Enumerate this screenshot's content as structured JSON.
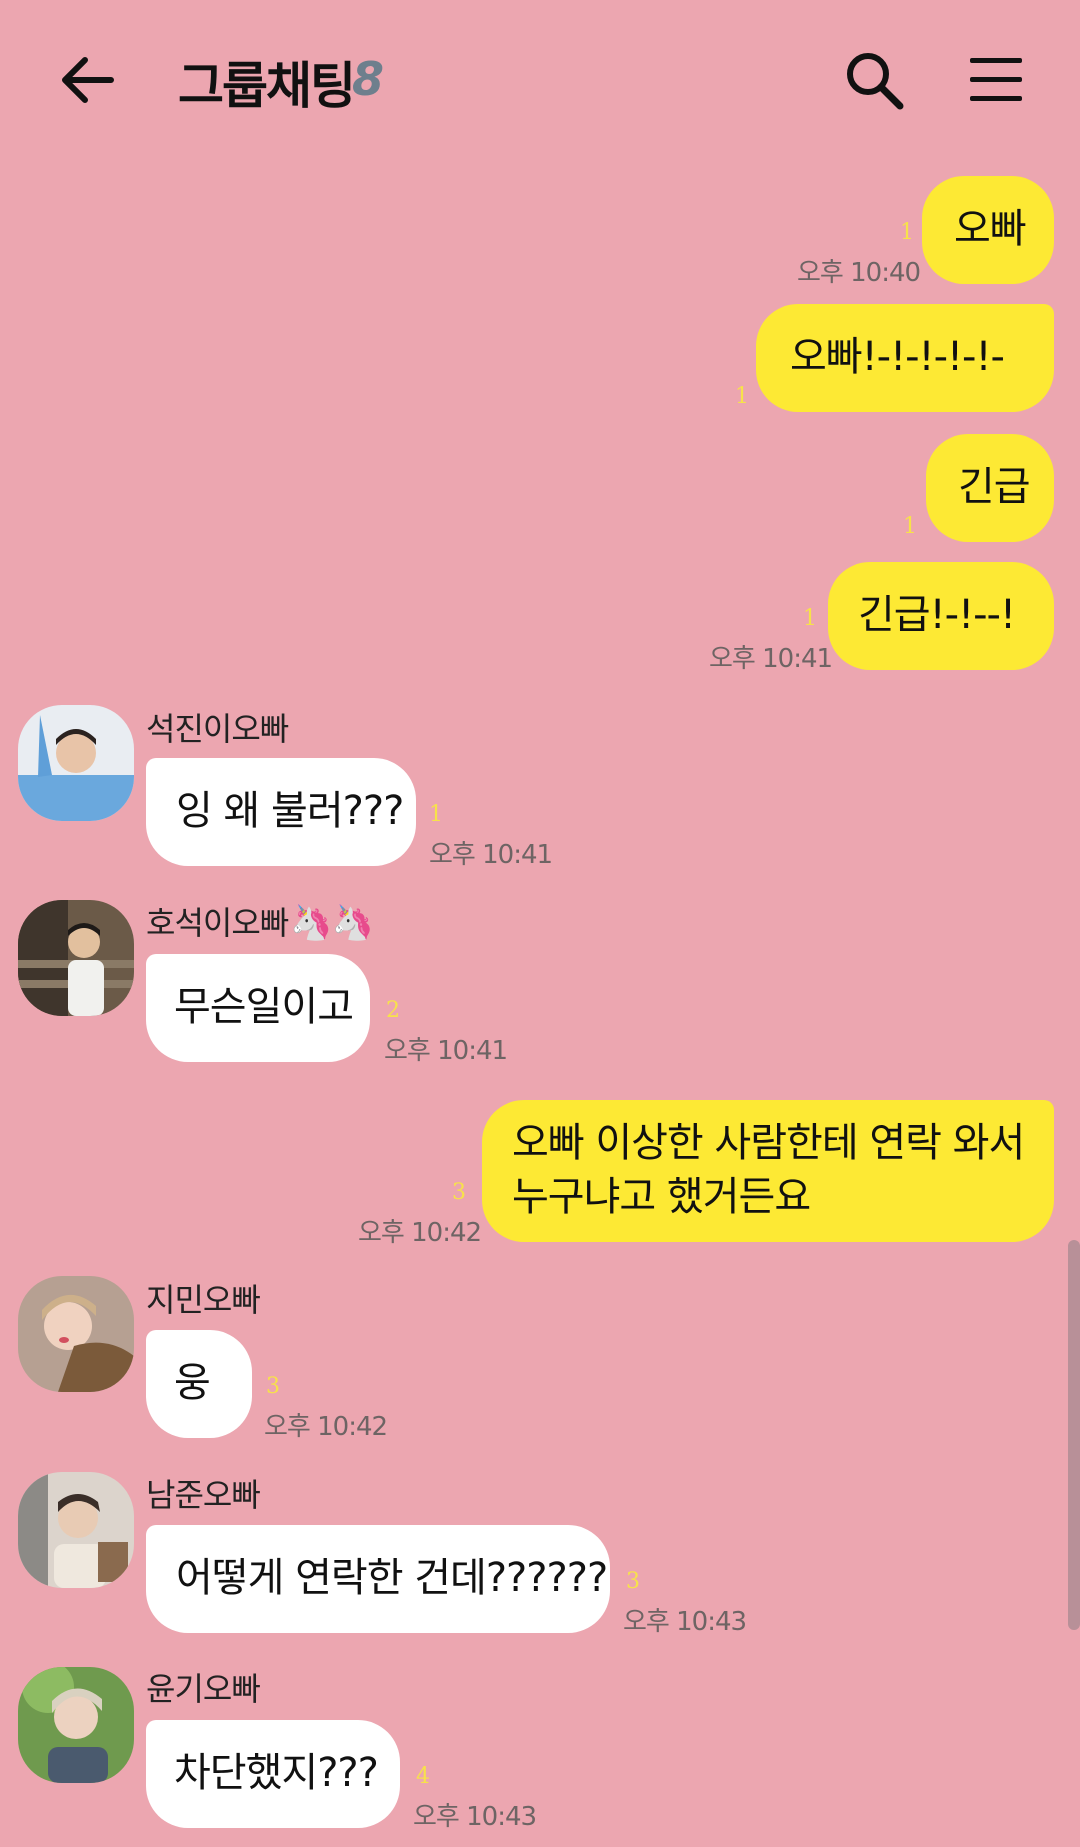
{
  "header": {
    "back_icon": "arrow-left-icon",
    "title": "그룹채팅",
    "member_count": "8",
    "search_icon": "search-icon",
    "menu_icon": "hamburger-menu-icon"
  },
  "messages_out": [
    {
      "text": "오빠",
      "read": "1",
      "time": "오후 10:40"
    },
    {
      "text": "오빠!-!-!-!-!-",
      "read": "1",
      "time": ""
    },
    {
      "text": "긴급",
      "read": "1",
      "time": ""
    },
    {
      "text": "긴급!-!--!",
      "read": "1",
      "time": "오후 10:41"
    },
    {
      "text_line1": "오빠 이상한 사람한테 연락 와서",
      "text_line2": "누구냐고 했거든요",
      "read": "3",
      "time": "오후 10:42"
    }
  ],
  "messages_in": [
    {
      "sender": "석진이오빠",
      "text": "잉 왜 불러???",
      "read": "1",
      "time": "오후 10:41"
    },
    {
      "sender": "호석이오빠",
      "sender_emoji": "🦄🦄",
      "text": "무슨일이고",
      "read": "2",
      "time": "오후 10:41"
    },
    {
      "sender": "지민오빠",
      "text": "웅",
      "read": "3",
      "time": "오후 10:42"
    },
    {
      "sender": "남준오빠",
      "text": "어떻게 연락한 건데??????",
      "read": "3",
      "time": "오후 10:43"
    },
    {
      "sender": "윤기오빠",
      "text": "차단했지???",
      "read": "4",
      "time": "오후 10:43"
    }
  ],
  "colors": {
    "background": "#eca6b0",
    "my_bubble": "#fde934",
    "their_bubble": "#ffffff",
    "read_count": "#f7e24a",
    "member_count": "#6e7f8d"
  }
}
